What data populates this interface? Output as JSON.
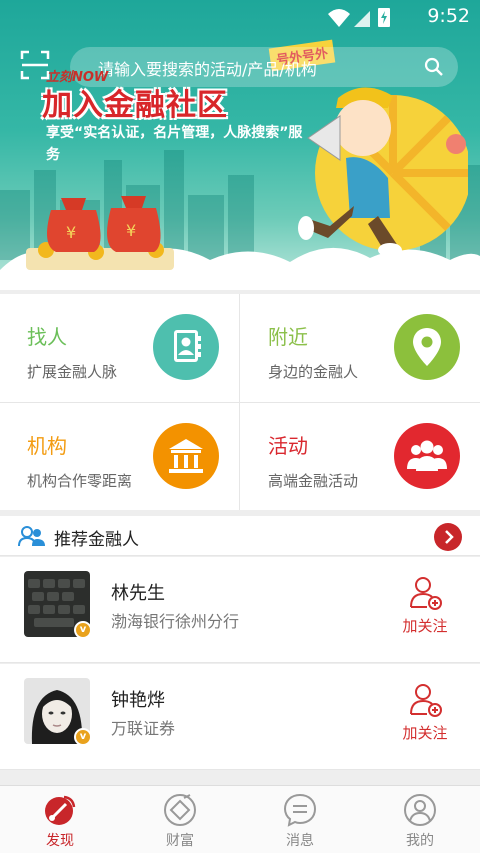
{
  "status_bar": {
    "time": "9:52"
  },
  "search": {
    "placeholder": "请输入要搜索的活动/产品/机构"
  },
  "banner": {
    "brand_small": "立刻NOW",
    "headline": "加入金融社区",
    "tag": "号外号外",
    "description": "享受“实名认证，名片管理，人脉搜索”服务"
  },
  "grid": [
    {
      "title": "找人",
      "subtitle": "扩展金融人脉",
      "title_color": "#6bbf59",
      "icon_color": "#4ebfae",
      "icon": "contact-book-icon"
    },
    {
      "title": "附近",
      "subtitle": "身边的金融人",
      "title_color": "#8cc04b",
      "icon_color": "#8cc03c",
      "icon": "location-pin-icon"
    },
    {
      "title": "机构",
      "subtitle": "机构合作零距离",
      "title_color": "#f39c12",
      "icon_color": "#f39200",
      "icon": "bank-icon"
    },
    {
      "title": "活动",
      "subtitle": "高端金融活动",
      "title_color": "#d9282f",
      "icon_color": "#e2282f",
      "icon": "group-icon"
    }
  ],
  "recommend": {
    "title": "推荐金融人",
    "people": [
      {
        "name": "林先生",
        "org": "渤海银行徐州分行",
        "follow_label": "加关注"
      },
      {
        "name": "钟艳烨",
        "org": "万联证券",
        "follow_label": "加关注"
      }
    ]
  },
  "bottom_nav": [
    {
      "label": "发现",
      "icon": "radar-icon",
      "active": true
    },
    {
      "label": "财富",
      "icon": "diamond-icon",
      "active": false
    },
    {
      "label": "消息",
      "icon": "chat-icon",
      "active": false
    },
    {
      "label": "我的",
      "icon": "profile-icon",
      "active": false
    }
  ],
  "colors": {
    "brand_red": "#c8262a",
    "banner_teal": "#2fb3a3"
  }
}
